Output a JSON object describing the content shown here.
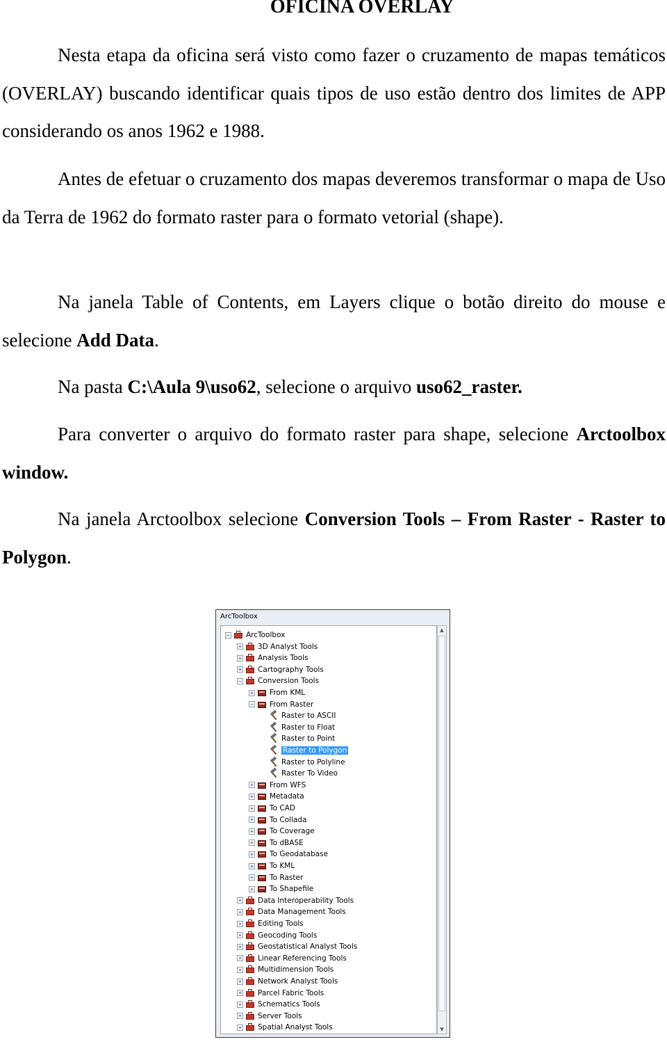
{
  "doc": {
    "title": "OFICINA OVERLAY",
    "p1": "Nesta etapa da oficina será visto como fazer o cruzamento de mapas temáticos (OVERLAY) buscando identificar quais tipos de uso estão dentro dos limites de APP considerando os anos 1962 e 1988.",
    "p2": "Antes de efetuar o cruzamento dos mapas deveremos transformar o mapa de Uso da Terra de 1962 do formato raster para o formato vetorial (shape).",
    "p3a": "Na janela Table of Contents, em Layers clique o botão direito do mouse e selecione ",
    "p3b": "Add Data",
    "p3c": ".",
    "p4a": "Na pasta ",
    "p4b": "C:\\Aula 9\\uso62",
    "p4c": ", selecione o arquivo ",
    "p4d": "uso62_raster.",
    "p5a": "Para converter o arquivo do formato raster para shape, selecione ",
    "p5b": "Arctoolbox window.",
    "p6a": "Na janela Arctoolbox selecione ",
    "p6b": "Conversion Tools – From Raster - Raster to Polygon",
    "p6c": "."
  },
  "window": {
    "title": "ArcToolbox",
    "tree": [
      {
        "label": "ArcToolbox",
        "level": 0,
        "icon": "toolbox-icon",
        "exp": "-"
      },
      {
        "label": "3D Analyst Tools",
        "level": 1,
        "icon": "toolbox-icon",
        "exp": "+"
      },
      {
        "label": "Analysis Tools",
        "level": 1,
        "icon": "toolbox-icon",
        "exp": "+"
      },
      {
        "label": "Cartography Tools",
        "level": 1,
        "icon": "toolbox-icon",
        "exp": "+"
      },
      {
        "label": "Conversion Tools",
        "level": 1,
        "icon": "toolbox-icon",
        "exp": "-"
      },
      {
        "label": "From KML",
        "level": 2,
        "icon": "toolset-icon",
        "exp": "+"
      },
      {
        "label": "From Raster",
        "level": 2,
        "icon": "toolset-icon",
        "exp": "-"
      },
      {
        "label": "Raster to ASCII",
        "level": 3,
        "icon": "hammer-icon",
        "exp": ""
      },
      {
        "label": "Raster to Float",
        "level": 3,
        "icon": "hammer-icon",
        "exp": ""
      },
      {
        "label": "Raster to Point",
        "level": 3,
        "icon": "hammer-icon",
        "exp": ""
      },
      {
        "label": "Raster to Polygon",
        "level": 3,
        "icon": "hammer-icon",
        "exp": "",
        "selected": true
      },
      {
        "label": "Raster to Polyline",
        "level": 3,
        "icon": "hammer-icon",
        "exp": ""
      },
      {
        "label": "Raster To Video",
        "level": 3,
        "icon": "hammer-icon",
        "exp": ""
      },
      {
        "label": "From WFS",
        "level": 2,
        "icon": "toolset-icon",
        "exp": "+"
      },
      {
        "label": "Metadata",
        "level": 2,
        "icon": "toolset-icon",
        "exp": "+"
      },
      {
        "label": "To CAD",
        "level": 2,
        "icon": "toolset-icon",
        "exp": "+"
      },
      {
        "label": "To Collada",
        "level": 2,
        "icon": "toolset-icon",
        "exp": "+"
      },
      {
        "label": "To Coverage",
        "level": 2,
        "icon": "toolset-icon",
        "exp": "+"
      },
      {
        "label": "To dBASE",
        "level": 2,
        "icon": "toolset-icon",
        "exp": "+"
      },
      {
        "label": "To Geodatabase",
        "level": 2,
        "icon": "toolset-icon",
        "exp": "+"
      },
      {
        "label": "To KML",
        "level": 2,
        "icon": "toolset-icon",
        "exp": "+"
      },
      {
        "label": "To Raster",
        "level": 2,
        "icon": "toolset-icon",
        "exp": "+"
      },
      {
        "label": "To Shapefile",
        "level": 2,
        "icon": "toolset-icon",
        "exp": "+"
      },
      {
        "label": "Data Interoperability Tools",
        "level": 1,
        "icon": "toolbox-icon",
        "exp": "+"
      },
      {
        "label": "Data Management Tools",
        "level": 1,
        "icon": "toolbox-icon",
        "exp": "+"
      },
      {
        "label": "Editing Tools",
        "level": 1,
        "icon": "toolbox-icon",
        "exp": "+"
      },
      {
        "label": "Geocoding Tools",
        "level": 1,
        "icon": "toolbox-icon",
        "exp": "+"
      },
      {
        "label": "Geostatistical Analyst Tools",
        "level": 1,
        "icon": "toolbox-icon",
        "exp": "+"
      },
      {
        "label": "Linear Referencing Tools",
        "level": 1,
        "icon": "toolbox-icon",
        "exp": "+"
      },
      {
        "label": "Multidimension Tools",
        "level": 1,
        "icon": "toolbox-icon",
        "exp": "+"
      },
      {
        "label": "Network Analyst Tools",
        "level": 1,
        "icon": "toolbox-icon",
        "exp": "+"
      },
      {
        "label": "Parcel Fabric Tools",
        "level": 1,
        "icon": "toolbox-icon",
        "exp": "+"
      },
      {
        "label": "Schematics Tools",
        "level": 1,
        "icon": "toolbox-icon",
        "exp": "+"
      },
      {
        "label": "Server Tools",
        "level": 1,
        "icon": "toolbox-icon",
        "exp": "+"
      },
      {
        "label": "Spatial Analyst Tools",
        "level": 1,
        "icon": "toolbox-icon",
        "exp": "+"
      }
    ]
  }
}
